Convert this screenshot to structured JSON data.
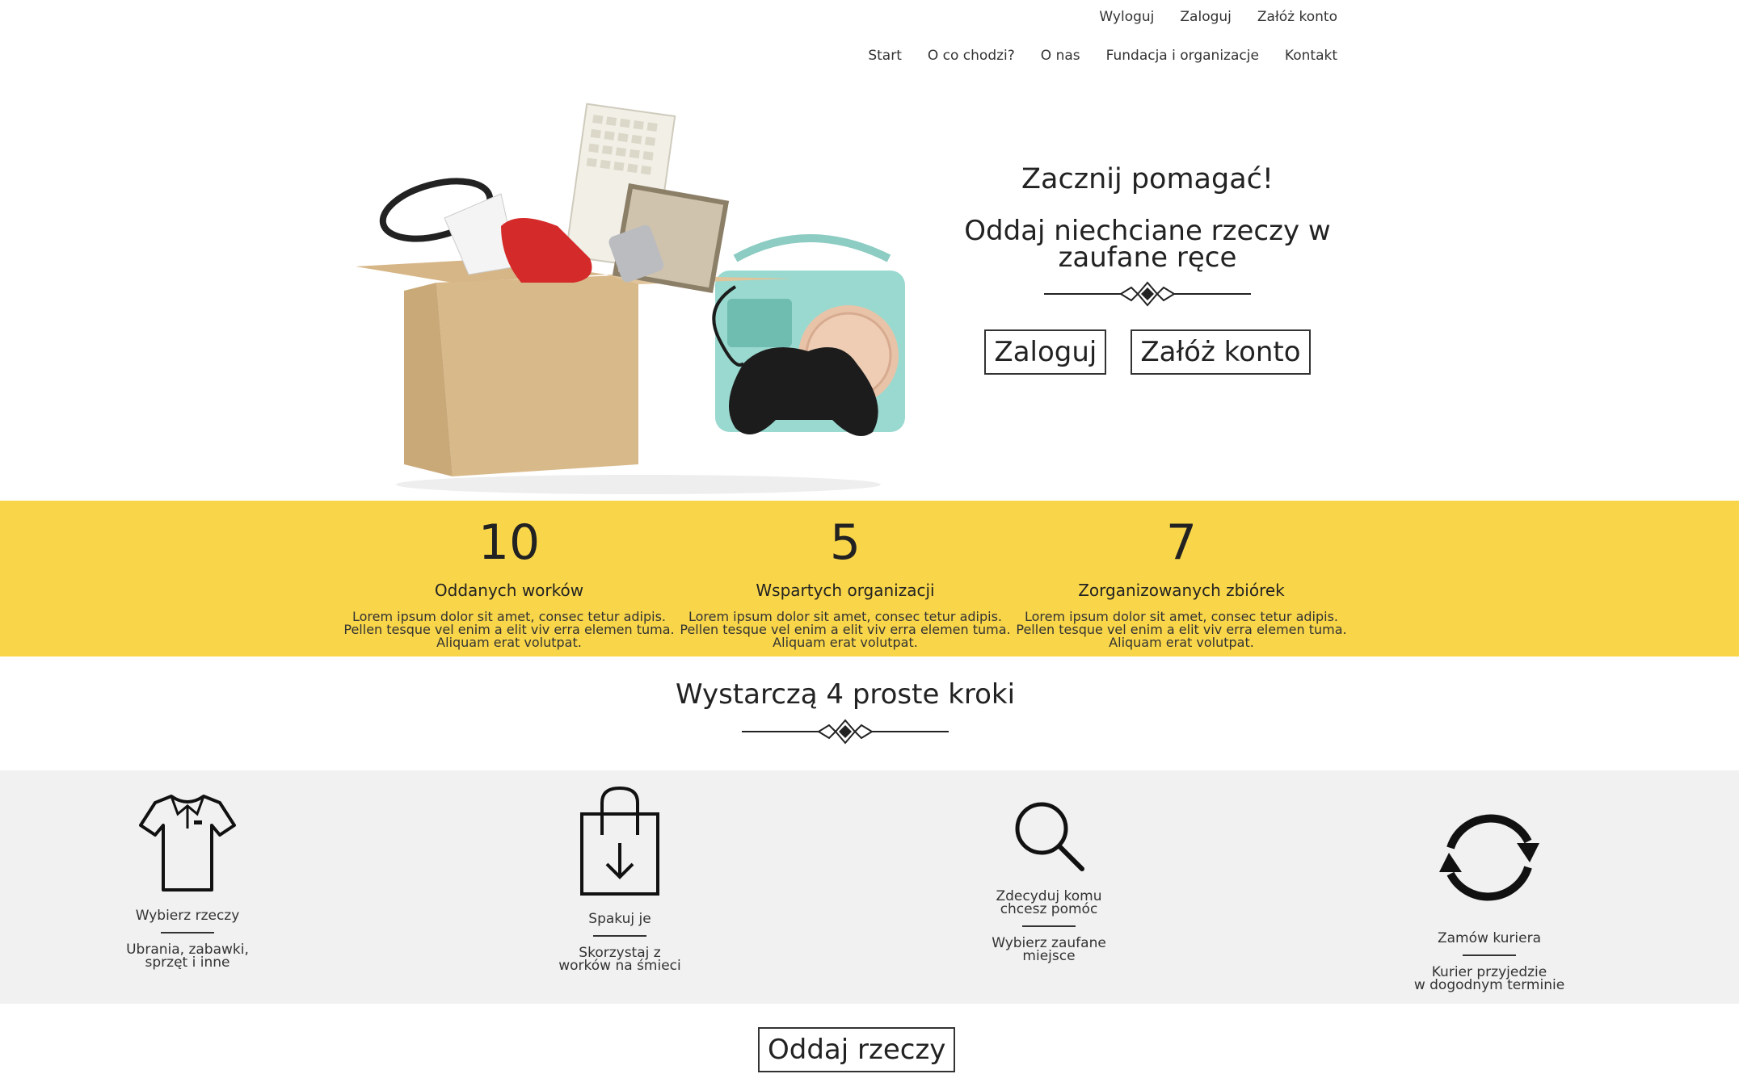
{
  "auth_nav": {
    "logout": "Wyloguj",
    "login": "Zaloguj",
    "register": "Załóż konto"
  },
  "main_nav": [
    "Start",
    "O co chodzi?",
    "O nas",
    "Fundacja i organizacje",
    "Kontakt"
  ],
  "hero": {
    "title": "Zacznij pomagać!",
    "subtitle": "Oddaj niechciane rzeczy w zaufane ręce",
    "login_button": "Zaloguj",
    "register_button": "Załóż konto"
  },
  "stats": [
    {
      "number": "10",
      "label": "Oddanych worków",
      "desc": [
        "Lorem ipsum dolor sit amet, consec tetur adipis.",
        "Pellen tesque vel enim a elit viv erra elemen tuma.",
        "Aliquam erat volutpat."
      ]
    },
    {
      "number": "5",
      "label": "Wspartych organizacji",
      "desc": [
        "Lorem ipsum dolor sit amet, consec tetur adipis.",
        "Pellen tesque vel enim a elit viv erra elemen tuma.",
        "Aliquam erat volutpat."
      ]
    },
    {
      "number": "7",
      "label": "Zorganizowanych zbiórek",
      "desc": [
        "Lorem ipsum dolor sit amet, consec tetur adipis.",
        "Pellen tesque vel enim a elit viv erra elemen tuma.",
        "Aliquam erat volutpat."
      ]
    }
  ],
  "steps_heading": "Wystarczą 4 proste kroki",
  "steps": [
    {
      "icon": "shirt-icon",
      "title": [
        "Wybierz rzeczy"
      ],
      "sub": [
        "Ubrania, zabawki,",
        "sprzęt i inne"
      ]
    },
    {
      "icon": "bag-icon",
      "title": [
        "Spakuj je"
      ],
      "sub": [
        "Skorzystaj z",
        "worków na śmieci"
      ]
    },
    {
      "icon": "search-icon",
      "title": [
        "Zdecyduj komu",
        "chcesz pomóc"
      ],
      "sub": [
        "Wybierz zaufane",
        "miejsce"
      ]
    },
    {
      "icon": "refresh-icon",
      "title": [
        "Zamów kuriera"
      ],
      "sub": [
        "Kurier przyjedzie",
        "w dogodnym terminie"
      ]
    }
  ],
  "bottom_button": "Oddaj rzeczy"
}
